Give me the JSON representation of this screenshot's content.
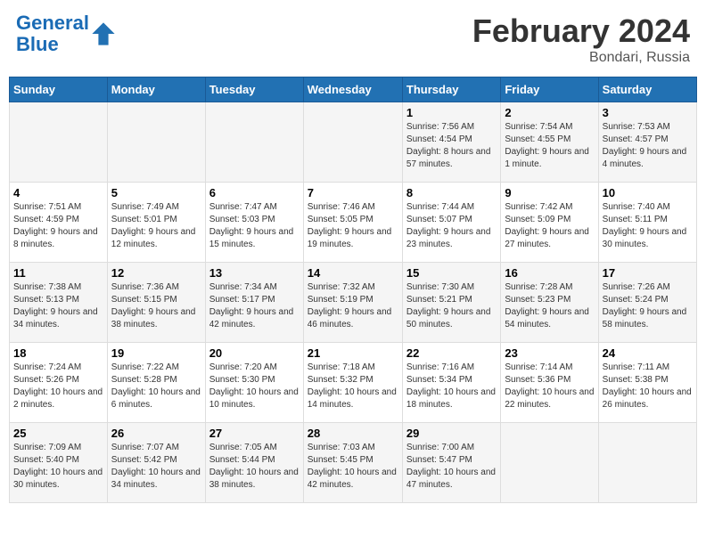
{
  "header": {
    "logo_line1": "General",
    "logo_line2": "Blue",
    "main_title": "February 2024",
    "sub_title": "Bondari, Russia"
  },
  "columns": [
    "Sunday",
    "Monday",
    "Tuesday",
    "Wednesday",
    "Thursday",
    "Friday",
    "Saturday"
  ],
  "weeks": [
    [
      {
        "day": "",
        "sunrise": "",
        "sunset": "",
        "daylight": ""
      },
      {
        "day": "",
        "sunrise": "",
        "sunset": "",
        "daylight": ""
      },
      {
        "day": "",
        "sunrise": "",
        "sunset": "",
        "daylight": ""
      },
      {
        "day": "",
        "sunrise": "",
        "sunset": "",
        "daylight": ""
      },
      {
        "day": "1",
        "sunrise": "Sunrise: 7:56 AM",
        "sunset": "Sunset: 4:54 PM",
        "daylight": "Daylight: 8 hours and 57 minutes."
      },
      {
        "day": "2",
        "sunrise": "Sunrise: 7:54 AM",
        "sunset": "Sunset: 4:55 PM",
        "daylight": "Daylight: 9 hours and 1 minute."
      },
      {
        "day": "3",
        "sunrise": "Sunrise: 7:53 AM",
        "sunset": "Sunset: 4:57 PM",
        "daylight": "Daylight: 9 hours and 4 minutes."
      }
    ],
    [
      {
        "day": "4",
        "sunrise": "Sunrise: 7:51 AM",
        "sunset": "Sunset: 4:59 PM",
        "daylight": "Daylight: 9 hours and 8 minutes."
      },
      {
        "day": "5",
        "sunrise": "Sunrise: 7:49 AM",
        "sunset": "Sunset: 5:01 PM",
        "daylight": "Daylight: 9 hours and 12 minutes."
      },
      {
        "day": "6",
        "sunrise": "Sunrise: 7:47 AM",
        "sunset": "Sunset: 5:03 PM",
        "daylight": "Daylight: 9 hours and 15 minutes."
      },
      {
        "day": "7",
        "sunrise": "Sunrise: 7:46 AM",
        "sunset": "Sunset: 5:05 PM",
        "daylight": "Daylight: 9 hours and 19 minutes."
      },
      {
        "day": "8",
        "sunrise": "Sunrise: 7:44 AM",
        "sunset": "Sunset: 5:07 PM",
        "daylight": "Daylight: 9 hours and 23 minutes."
      },
      {
        "day": "9",
        "sunrise": "Sunrise: 7:42 AM",
        "sunset": "Sunset: 5:09 PM",
        "daylight": "Daylight: 9 hours and 27 minutes."
      },
      {
        "day": "10",
        "sunrise": "Sunrise: 7:40 AM",
        "sunset": "Sunset: 5:11 PM",
        "daylight": "Daylight: 9 hours and 30 minutes."
      }
    ],
    [
      {
        "day": "11",
        "sunrise": "Sunrise: 7:38 AM",
        "sunset": "Sunset: 5:13 PM",
        "daylight": "Daylight: 9 hours and 34 minutes."
      },
      {
        "day": "12",
        "sunrise": "Sunrise: 7:36 AM",
        "sunset": "Sunset: 5:15 PM",
        "daylight": "Daylight: 9 hours and 38 minutes."
      },
      {
        "day": "13",
        "sunrise": "Sunrise: 7:34 AM",
        "sunset": "Sunset: 5:17 PM",
        "daylight": "Daylight: 9 hours and 42 minutes."
      },
      {
        "day": "14",
        "sunrise": "Sunrise: 7:32 AM",
        "sunset": "Sunset: 5:19 PM",
        "daylight": "Daylight: 9 hours and 46 minutes."
      },
      {
        "day": "15",
        "sunrise": "Sunrise: 7:30 AM",
        "sunset": "Sunset: 5:21 PM",
        "daylight": "Daylight: 9 hours and 50 minutes."
      },
      {
        "day": "16",
        "sunrise": "Sunrise: 7:28 AM",
        "sunset": "Sunset: 5:23 PM",
        "daylight": "Daylight: 9 hours and 54 minutes."
      },
      {
        "day": "17",
        "sunrise": "Sunrise: 7:26 AM",
        "sunset": "Sunset: 5:24 PM",
        "daylight": "Daylight: 9 hours and 58 minutes."
      }
    ],
    [
      {
        "day": "18",
        "sunrise": "Sunrise: 7:24 AM",
        "sunset": "Sunset: 5:26 PM",
        "daylight": "Daylight: 10 hours and 2 minutes."
      },
      {
        "day": "19",
        "sunrise": "Sunrise: 7:22 AM",
        "sunset": "Sunset: 5:28 PM",
        "daylight": "Daylight: 10 hours and 6 minutes."
      },
      {
        "day": "20",
        "sunrise": "Sunrise: 7:20 AM",
        "sunset": "Sunset: 5:30 PM",
        "daylight": "Daylight: 10 hours and 10 minutes."
      },
      {
        "day": "21",
        "sunrise": "Sunrise: 7:18 AM",
        "sunset": "Sunset: 5:32 PM",
        "daylight": "Daylight: 10 hours and 14 minutes."
      },
      {
        "day": "22",
        "sunrise": "Sunrise: 7:16 AM",
        "sunset": "Sunset: 5:34 PM",
        "daylight": "Daylight: 10 hours and 18 minutes."
      },
      {
        "day": "23",
        "sunrise": "Sunrise: 7:14 AM",
        "sunset": "Sunset: 5:36 PM",
        "daylight": "Daylight: 10 hours and 22 minutes."
      },
      {
        "day": "24",
        "sunrise": "Sunrise: 7:11 AM",
        "sunset": "Sunset: 5:38 PM",
        "daylight": "Daylight: 10 hours and 26 minutes."
      }
    ],
    [
      {
        "day": "25",
        "sunrise": "Sunrise: 7:09 AM",
        "sunset": "Sunset: 5:40 PM",
        "daylight": "Daylight: 10 hours and 30 minutes."
      },
      {
        "day": "26",
        "sunrise": "Sunrise: 7:07 AM",
        "sunset": "Sunset: 5:42 PM",
        "daylight": "Daylight: 10 hours and 34 minutes."
      },
      {
        "day": "27",
        "sunrise": "Sunrise: 7:05 AM",
        "sunset": "Sunset: 5:44 PM",
        "daylight": "Daylight: 10 hours and 38 minutes."
      },
      {
        "day": "28",
        "sunrise": "Sunrise: 7:03 AM",
        "sunset": "Sunset: 5:45 PM",
        "daylight": "Daylight: 10 hours and 42 minutes."
      },
      {
        "day": "29",
        "sunrise": "Sunrise: 7:00 AM",
        "sunset": "Sunset: 5:47 PM",
        "daylight": "Daylight: 10 hours and 47 minutes."
      },
      {
        "day": "",
        "sunrise": "",
        "sunset": "",
        "daylight": ""
      },
      {
        "day": "",
        "sunrise": "",
        "sunset": "",
        "daylight": ""
      }
    ]
  ]
}
